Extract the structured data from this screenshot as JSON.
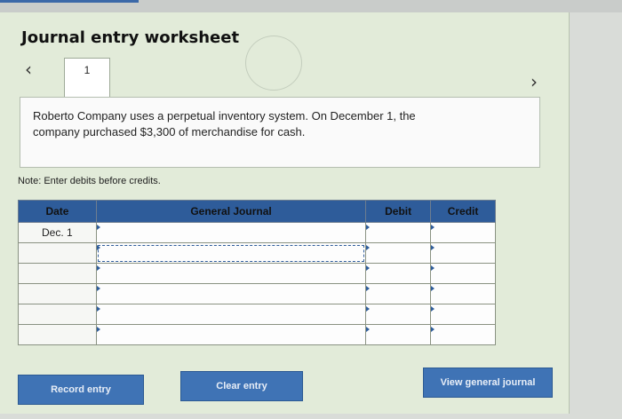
{
  "header": {
    "title": "Journal entry worksheet"
  },
  "navigation": {
    "prev_icon": "chevron-left",
    "next_icon": "chevron-right",
    "current_tab": "1"
  },
  "problem": {
    "line1": "Roberto Company uses a perpetual inventory system. On December 1, the",
    "line2": "company purchased $3,300 of merchandise for cash."
  },
  "note": "Note: Enter debits before credits.",
  "journal": {
    "columns": {
      "date": "Date",
      "general_journal": "General Journal",
      "debit": "Debit",
      "credit": "Credit"
    },
    "rows": [
      {
        "date": "Dec. 1",
        "account": "",
        "debit": "",
        "credit": ""
      },
      {
        "date": "",
        "account": "",
        "debit": "",
        "credit": ""
      },
      {
        "date": "",
        "account": "",
        "debit": "",
        "credit": ""
      },
      {
        "date": "",
        "account": "",
        "debit": "",
        "credit": ""
      },
      {
        "date": "",
        "account": "",
        "debit": "",
        "credit": ""
      },
      {
        "date": "",
        "account": "",
        "debit": "",
        "credit": ""
      }
    ]
  },
  "buttons": {
    "record": "Record entry",
    "clear": "Clear entry",
    "view": "View general journal"
  },
  "colors": {
    "panel_bg": "#e2ebd9",
    "header_blue": "#2e5c9a",
    "button_blue": "#3f73b5"
  }
}
